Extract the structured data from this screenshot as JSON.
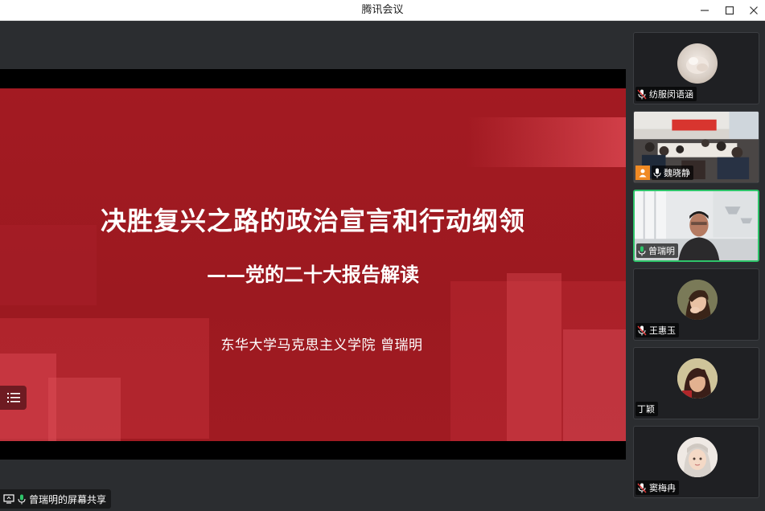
{
  "window": {
    "title": "腾讯会议"
  },
  "slide": {
    "title": "决胜复兴之路的政治宣言和行动纲领",
    "subtitle": "——党的二十大报告解读",
    "author": "东华大学马克思主义学院   曾瑞明"
  },
  "share": {
    "label": "曾瑞明的屏幕共享"
  },
  "participants": [
    {
      "name": "纺服闵语涵",
      "mic": "muted"
    },
    {
      "name": "魏晓静",
      "mic": "on"
    },
    {
      "name": "曾瑞明",
      "mic": "on"
    },
    {
      "name": "王惠玉",
      "mic": "muted"
    },
    {
      "name": "丁颖",
      "mic": "none"
    },
    {
      "name": "窦梅冉",
      "mic": "muted"
    }
  ],
  "colors": {
    "slide_red": "#a11b22",
    "active_border": "#2ec46a",
    "mic_on": "#2ec46a",
    "host_badge": "#f08a24"
  },
  "icons": [
    "minimize-icon",
    "maximize-icon",
    "close-icon",
    "toc-list-icon",
    "screen-share-icon",
    "mic-icon",
    "mic-muted-icon",
    "host-badge-icon"
  ]
}
